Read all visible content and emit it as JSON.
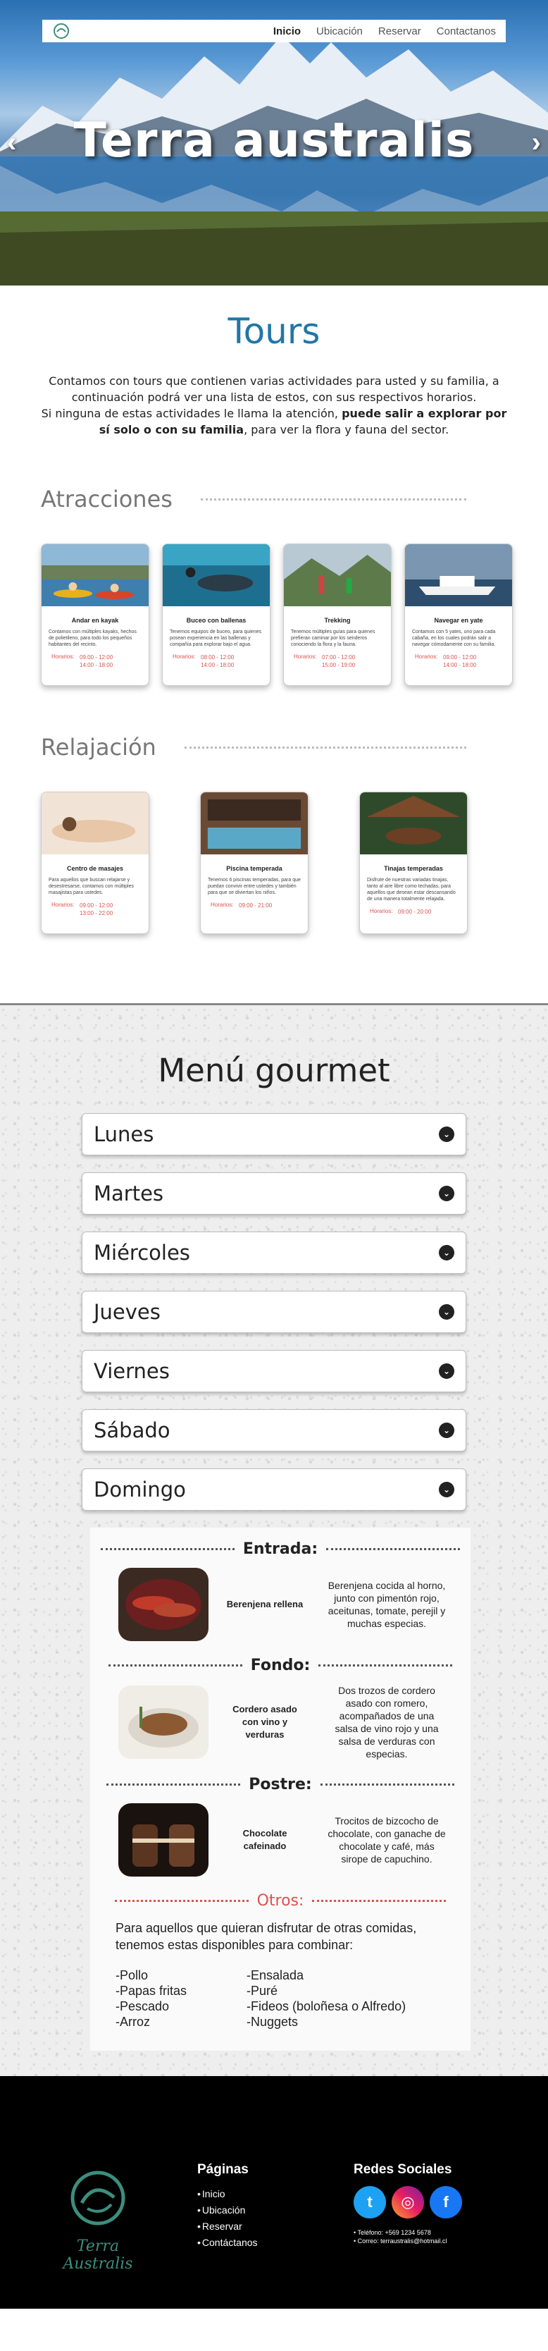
{
  "nav": {
    "items": [
      "Inicio",
      "Ubicación",
      "Reservar",
      "Contactanos"
    ]
  },
  "hero": {
    "title": "Terra australis",
    "prev": "‹",
    "next": "›"
  },
  "tours": {
    "title": "Tours",
    "intro_1": "Contamos con tours que contienen varias actividades para usted y su familia, a continuación podrá ver una lista de estos, con sus respectivos horarios.",
    "intro_2": "Si ninguna de estas actividades le llama la atención, ",
    "intro_bold": "puede salir a explorar por sí solo o con su familia",
    "intro_3": ", para ver la flora y fauna del sector."
  },
  "attractions": {
    "heading": "Atracciones",
    "cards": [
      {
        "title": "Andar en kayak",
        "desc": "Contamos con múltiples kayaks, hechos de polietileno, para todo los pequeños habitantes del recinto.",
        "hours_label": "Horarios:",
        "hours": [
          "09:00 - 12:00",
          "14:00 - 18:00"
        ]
      },
      {
        "title": "Buceo con ballenas",
        "desc": "Tenemos equipos de buceo, para quienes posean experiencia en las ballenas y compañía para explorar bajo el agua.",
        "hours_label": "Horarios:",
        "hours": [
          "08:00 - 12:00",
          "14:00 - 18:00"
        ]
      },
      {
        "title": "Trekking",
        "desc": "Tenemos múltiples guías para quienes prefieran caminar por los senderos conociendo la flora y la fauna.",
        "hours_label": "Horarios:",
        "hours": [
          "07:00 - 12:00",
          "15:00 - 19:00"
        ]
      },
      {
        "title": "Navegar en yate",
        "desc": "Contamos con 5 yates, uno para cada cabaña, en los cuales podrán salir a navegar cómodamente con su familia.",
        "hours_label": "Horarios:",
        "hours": [
          "09:00 - 12:00",
          "14:00 - 18:00"
        ]
      }
    ]
  },
  "relax": {
    "heading": "Relajación",
    "cards": [
      {
        "title": "Centro de masajes",
        "desc": "Para aquellos que buscan relajarse y desestresarse, contamos con múltiples masajistas para ustedes.",
        "hours_label": "Horarios:",
        "hours": [
          "09:00 - 12:00",
          "13:00 - 22:00"
        ]
      },
      {
        "title": "Piscina temperada",
        "desc": "Tenemos 6 piscinas temperadas, para que puedan convivir entre ustedes y también para que se diviertan los niños.",
        "hours_label": "Horarios:",
        "hours": [
          "09:00 - 21:00"
        ]
      },
      {
        "title": "Tinajas temperadas",
        "desc": "Disfrute de nuestras variadas tinajas, tanto al aire libre como techadas, para aquellos que desean estar descansando de una manera totalmente relajada.",
        "hours_label": "Horarios:",
        "hours": [
          "09:00 - 20:00"
        ]
      }
    ]
  },
  "menu": {
    "title": "Menú gourmet",
    "days": [
      "Lunes",
      "Martes",
      "Miércoles",
      "Jueves",
      "Viernes",
      "Sábado",
      "Domingo"
    ],
    "courses": [
      {
        "label": "Entrada:",
        "dish": "Berenjena rellena",
        "desc": "Berenjena cocida al horno, junto con pimentón rojo, aceitunas, tomate, perejil y muchas especias."
      },
      {
        "label": "Fondo:",
        "dish": "Cordero asado con vino y verduras",
        "desc": "Dos trozos de cordero asado con romero, acompañados de una salsa de vino rojo y una salsa de verduras con especias."
      },
      {
        "label": "Postre:",
        "dish": "Chocolate cafeinado",
        "desc": "Trocitos de bizcocho de chocolate, con ganache de chocolate y café, más sirope de capuchino."
      }
    ],
    "others": {
      "label": "Otros:",
      "text": "Para aquellos que quieran disfrutar de otras comidas, tenemos estas disponibles para combinar:",
      "col1": [
        "-Pollo",
        "-Papas fritas",
        "-Pescado",
        "-Arroz"
      ],
      "col2": [
        "-Ensalada",
        "-Puré",
        "-Fideos (boloñesa o Alfredo)",
        "-Nuggets"
      ]
    }
  },
  "footer": {
    "brand": "Terra Australis",
    "pages_title": "Páginas",
    "pages": [
      "Inicio",
      "Ubicación",
      "Reservar",
      "Contáctanos"
    ],
    "social_title": "Redes Sociales",
    "phone": "• Teléfono: +569 1234 5678",
    "email": "• Correo: terraustralis@hotmail.cl"
  },
  "colors": {
    "accent": "#1f77a6",
    "hours": "#d9534f",
    "brand_green": "#3c8e7e"
  },
  "icons": [
    "site-logo-icon",
    "chevron-down-icon",
    "twitter-icon",
    "instagram-icon",
    "facebook-icon"
  ]
}
